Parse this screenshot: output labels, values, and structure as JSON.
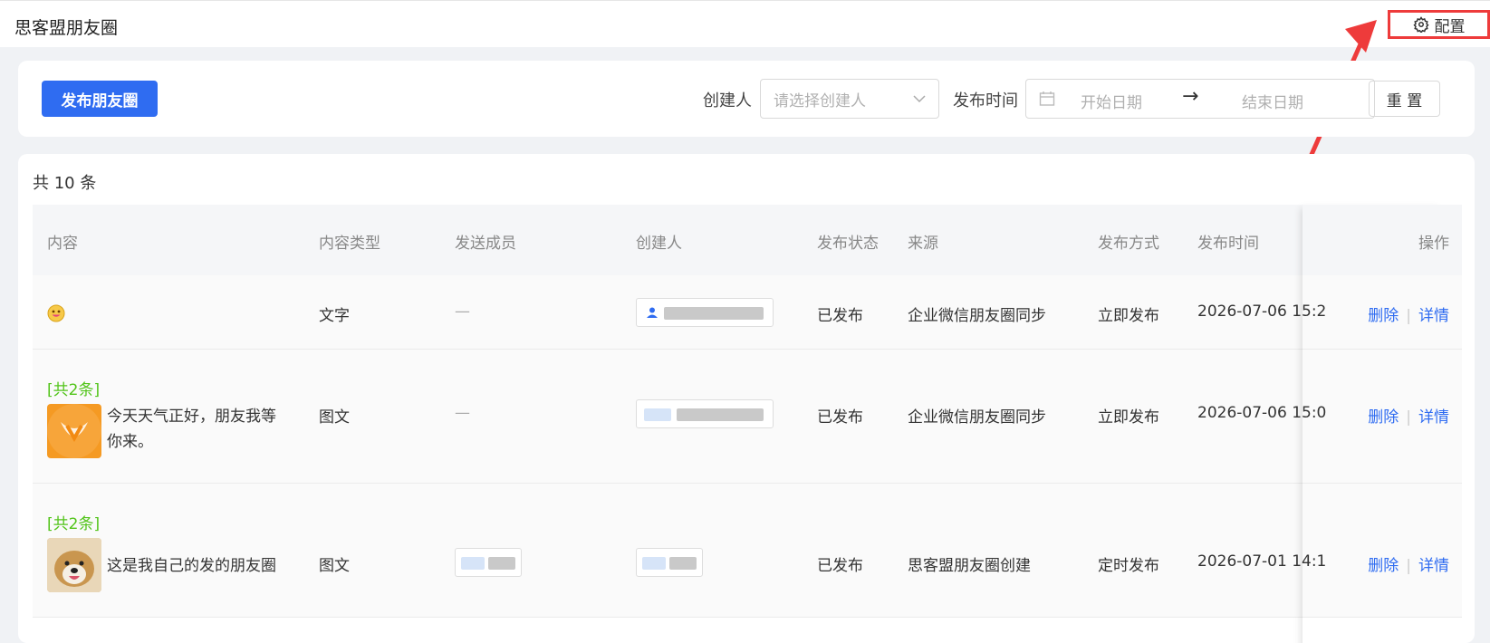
{
  "app": {
    "title": "思客盟朋友圈",
    "config_label": "配置",
    "config_icon": "gear-icon"
  },
  "filters": {
    "publish_label": "发布朋友圈",
    "creator_label": "创建人",
    "creator_placeholder": "请选择创建人",
    "time_label": "发布时间",
    "start_placeholder": "开始日期",
    "arrow": "→",
    "end_placeholder": "结束日期",
    "reset_label": "重 置"
  },
  "list": {
    "total": "共 10 条",
    "columns": [
      "内容",
      "内容类型",
      "发送成员",
      "创建人",
      "发布状态",
      "来源",
      "发布方式",
      "发布时间",
      "操作"
    ],
    "rows": [
      {
        "count": "",
        "text": "",
        "type": "文字",
        "members": "—",
        "status": "已发布",
        "source": "企业微信朋友圈同步",
        "method": "立即发布",
        "time": "2026-07-06 15:2",
        "delete": "删除",
        "detail": "详情"
      },
      {
        "count": "[共2条]",
        "text": "今天天气正好，朋友我等你来。",
        "type": "图文",
        "members": "—",
        "status": "已发布",
        "source": "企业微信朋友圈同步",
        "method": "立即发布",
        "time": "2026-07-06 15:0",
        "delete": "删除",
        "detail": "详情"
      },
      {
        "count": "[共2条]",
        "text": "这是我自己的发的朋友圈",
        "type": "图文",
        "members": "",
        "status": "已发布",
        "source": "思客盟朋友圈创建",
        "method": "定时发布",
        "time": "2026-07-01 14:1",
        "delete": "删除",
        "detail": "详情"
      }
    ],
    "separator": "|"
  },
  "colors": {
    "primary": "#2f6cf1",
    "highlight": "#ee3b3b",
    "tag_green": "#52c41a"
  }
}
